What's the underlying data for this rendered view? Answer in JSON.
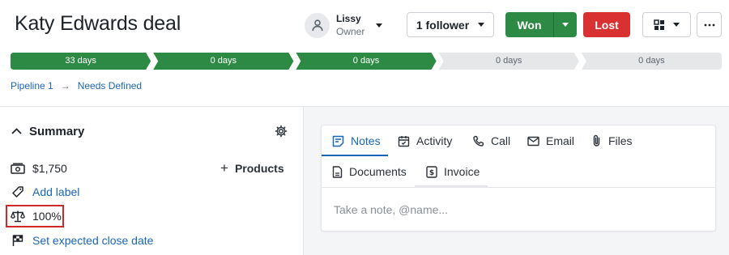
{
  "header": {
    "deal_title": "Katy Edwards deal",
    "owner": {
      "name": "Lissy",
      "role": "Owner"
    },
    "follower_label": "1 follower",
    "won_label": "Won",
    "lost_label": "Lost"
  },
  "pipeline": {
    "stages": [
      {
        "label": "33 days",
        "status": "complete"
      },
      {
        "label": "0 days",
        "status": "complete"
      },
      {
        "label": "0 days",
        "status": "complete"
      },
      {
        "label": "0 days",
        "status": "pending"
      },
      {
        "label": "0 days",
        "status": "pending"
      }
    ],
    "colors": {
      "complete": "#2d8a45",
      "pending": "#e6e7e9",
      "complete_text": "#ffffff",
      "pending_text": "#5c646c"
    }
  },
  "breadcrumb": {
    "pipeline": "Pipeline 1",
    "stage": "Needs Defined",
    "separator": "→"
  },
  "summary": {
    "title": "Summary",
    "value": "$1,750",
    "products_label": "Products",
    "add_label": "Add label",
    "probability": "100%",
    "close_date_label": "Set expected close date"
  },
  "notes_panel": {
    "tabs": [
      {
        "label": "Notes",
        "icon": "note-icon",
        "active": true
      },
      {
        "label": "Activity",
        "icon": "calendar-icon",
        "active": false
      },
      {
        "label": "Call",
        "icon": "phone-icon",
        "active": false
      },
      {
        "label": "Email",
        "icon": "email-icon",
        "active": false
      },
      {
        "label": "Files",
        "icon": "paperclip-icon",
        "active": false
      },
      {
        "label": "Documents",
        "icon": "document-icon",
        "active": false
      },
      {
        "label": "Invoice",
        "icon": "invoice-icon",
        "active": false
      }
    ],
    "placeholder": "Take a note, @name..."
  },
  "colors": {
    "accent": "#1a66b8",
    "won": "#2d8a45",
    "lost": "#d93131",
    "highlight_box": "#cf2a2a"
  }
}
